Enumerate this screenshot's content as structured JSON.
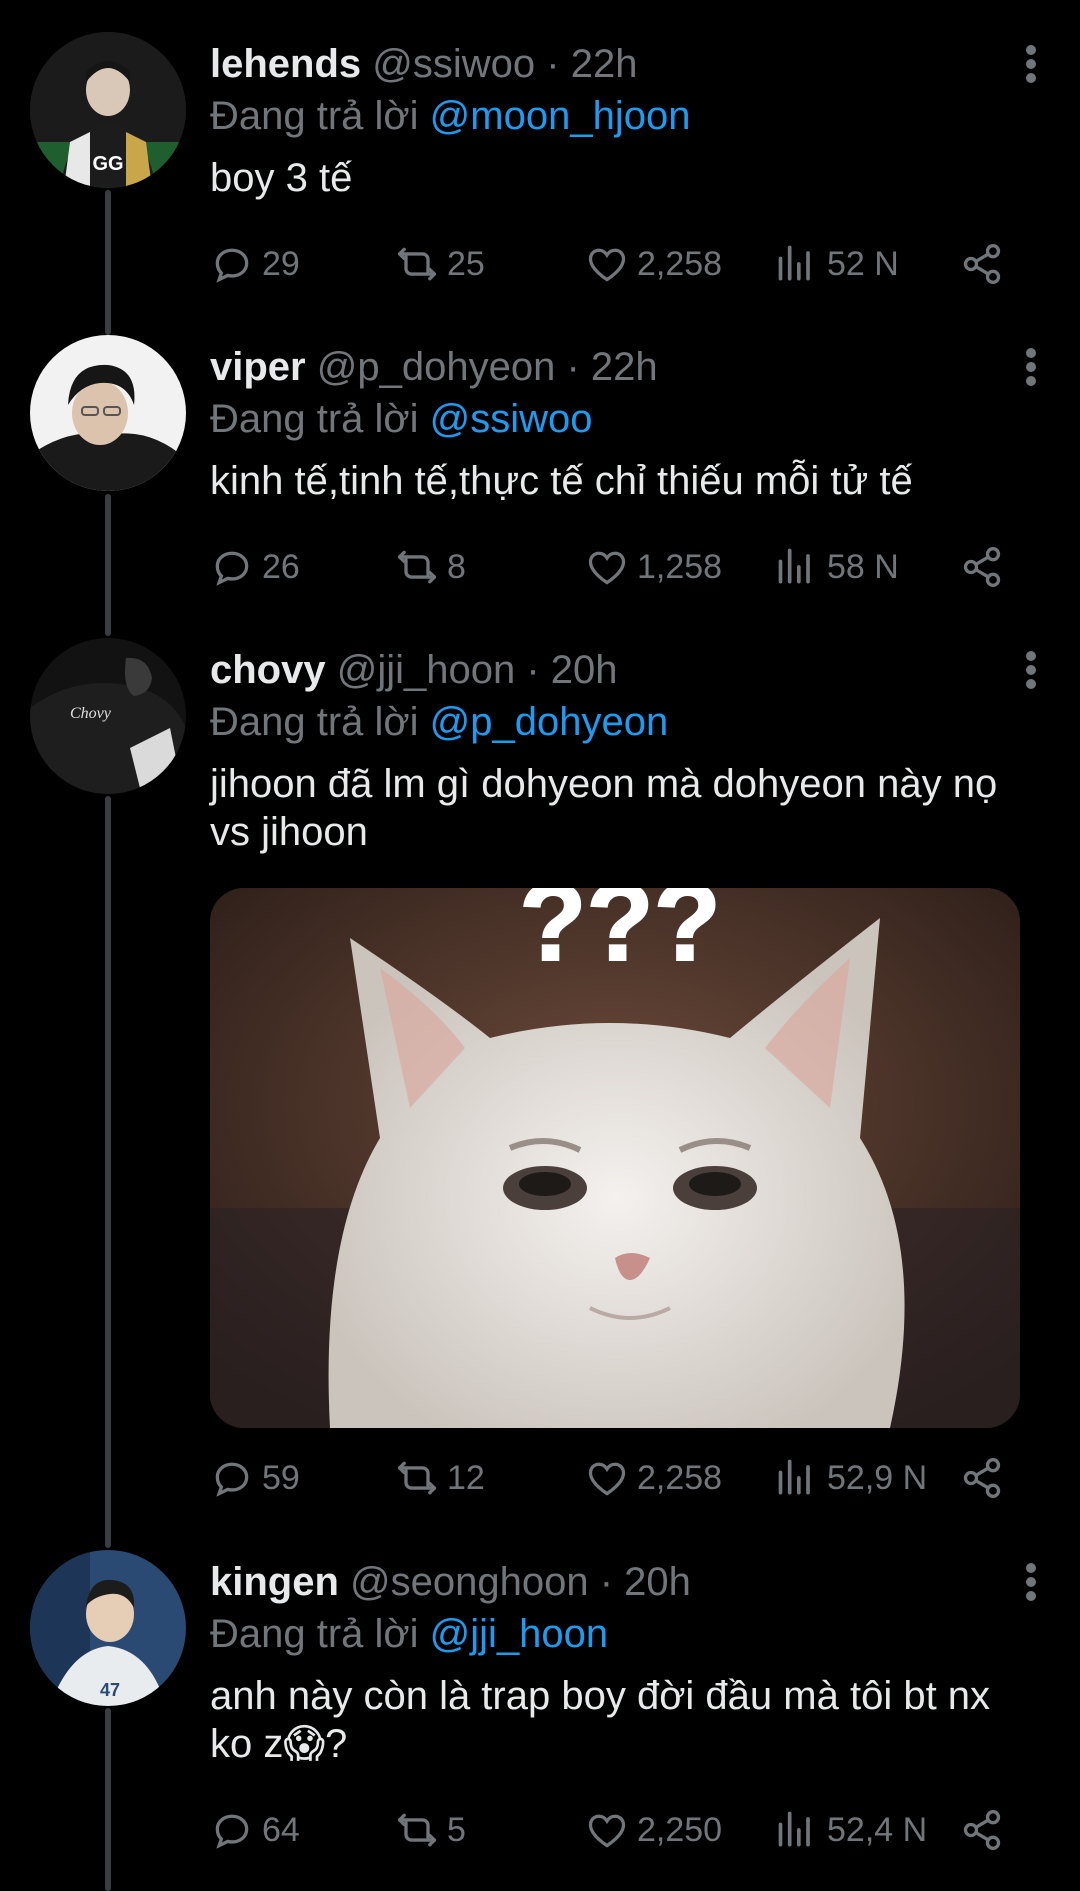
{
  "tweets": [
    {
      "name": "lehends",
      "handle": "@ssiwoo",
      "time": "· 22h",
      "replying_label": "Đang trả lời",
      "replying_to": "@moon_hjoon",
      "text": "boy 3 tế",
      "replies": "29",
      "retweets": "25",
      "likes": "2,258",
      "views": "52 N"
    },
    {
      "name": "viper",
      "handle": "@p_dohyeon",
      "time": "· 22h",
      "replying_label": "Đang trả lời",
      "replying_to": "@ssiwoo",
      "text": "kinh tế,tinh tế,thực tế chỉ thiếu mỗi tử tế",
      "replies": "26",
      "retweets": "8",
      "likes": "1,258",
      "views": "58 N"
    },
    {
      "name": "chovy",
      "handle": "@jji_hoon",
      "time": "· 20h",
      "replying_label": "Đang trả lời",
      "replying_to": "@p_dohyeon",
      "text": "jihoon đã lm gì dohyeon mà dohyeon này nọ vs jihoon",
      "media_caption": "???",
      "replies": "59",
      "retweets": "12",
      "likes": "2,258",
      "views": "52,9 N"
    },
    {
      "name": "kingen",
      "handle": "@seonghoon",
      "time": "· 20h",
      "replying_label": "Đang trả lời",
      "replying_to": "@jji_hoon",
      "text": "anh này còn là trap boy đời đầu mà tôi bt nx ko z😱?",
      "replies": "64",
      "retweets": "5",
      "likes": "2,250",
      "views": "52,4 N"
    }
  ],
  "colors": {
    "background": "#000000",
    "text": "#e7e9ea",
    "secondary": "#71767b",
    "link": "#1d9bf0"
  }
}
